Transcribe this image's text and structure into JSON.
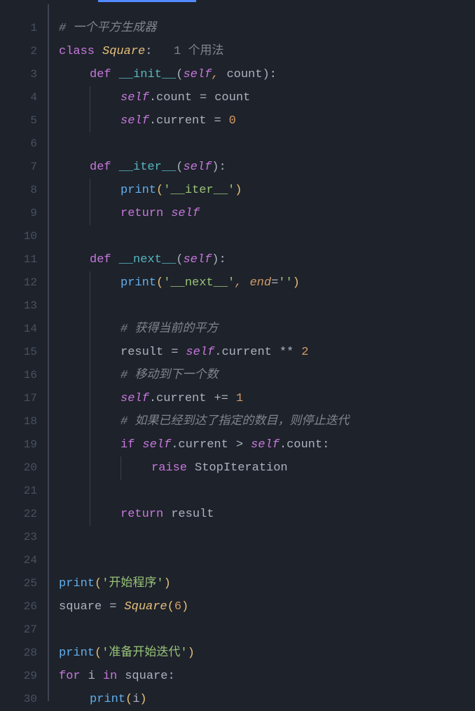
{
  "line_count": 30,
  "lines": {
    "l1": {
      "comment": "#  一个平方生成器"
    },
    "l2": {
      "kw_class": "class",
      "class_name": "Square",
      "colon": ":",
      "hint": "1 个用法"
    },
    "l3": {
      "kw_def": "def",
      "fn": "__init__",
      "lp": "(",
      "self": "self",
      "comma": ",",
      "param": "count",
      "rp": ")",
      "colon": ":"
    },
    "l4": {
      "self": "self",
      "dot": ".",
      "attr": "count",
      "eq": "=",
      "val": "count"
    },
    "l5": {
      "self": "self",
      "dot": ".",
      "attr": "current",
      "eq": "=",
      "num": "0"
    },
    "l7": {
      "kw_def": "def",
      "fn": "__iter__",
      "lp": "(",
      "self": "self",
      "rp": ")",
      "colon": ":"
    },
    "l8": {
      "func": "print",
      "lp": "(",
      "str": "'__iter__'",
      "rp": ")"
    },
    "l9": {
      "kw": "return",
      "self": "self"
    },
    "l11": {
      "kw_def": "def",
      "fn": "__next__",
      "lp": "(",
      "self": "self",
      "rp": ")",
      "colon": ":"
    },
    "l12": {
      "func": "print",
      "lp": "(",
      "str": "'__next__'",
      "comma": ",",
      "kwarg": "end",
      "eq": "=",
      "str2": "''",
      "rp": ")"
    },
    "l14": {
      "comment": "#  获得当前的平方"
    },
    "l15": {
      "var": "result",
      "eq": "=",
      "self": "self",
      "dot": ".",
      "attr": "current",
      "op": "**",
      "num": "2"
    },
    "l16": {
      "comment": "#  移动到下一个数"
    },
    "l17": {
      "self": "self",
      "dot": ".",
      "attr": "current",
      "op": "+=",
      "num": "1"
    },
    "l18": {
      "comment": "#  如果已经到达了指定的数目，则停止迭代"
    },
    "l19": {
      "kw": "if",
      "self": "self",
      "dot": ".",
      "attr": "current",
      "op": ">",
      "self2": "self",
      "dot2": ".",
      "attr2": "count",
      "colon": ":"
    },
    "l20": {
      "kw": "raise",
      "exc": "StopIteration"
    },
    "l22": {
      "kw": "return",
      "var": "result"
    },
    "l25": {
      "func": "print",
      "lp": "(",
      "str": "'开始程序'",
      "rp": ")"
    },
    "l26": {
      "var": "square",
      "eq": "=",
      "cls": "Square",
      "lp": "(",
      "num": "6",
      "rp": ")"
    },
    "l28": {
      "func": "print",
      "lp": "(",
      "str": "'准备开始迭代'",
      "rp": ")"
    },
    "l29": {
      "kw": "for",
      "var": "i",
      "kw2": "in",
      "it": "square",
      "colon": ":"
    },
    "l30": {
      "func": "print",
      "lp": "(",
      "var": "i",
      "rp": ")"
    }
  }
}
